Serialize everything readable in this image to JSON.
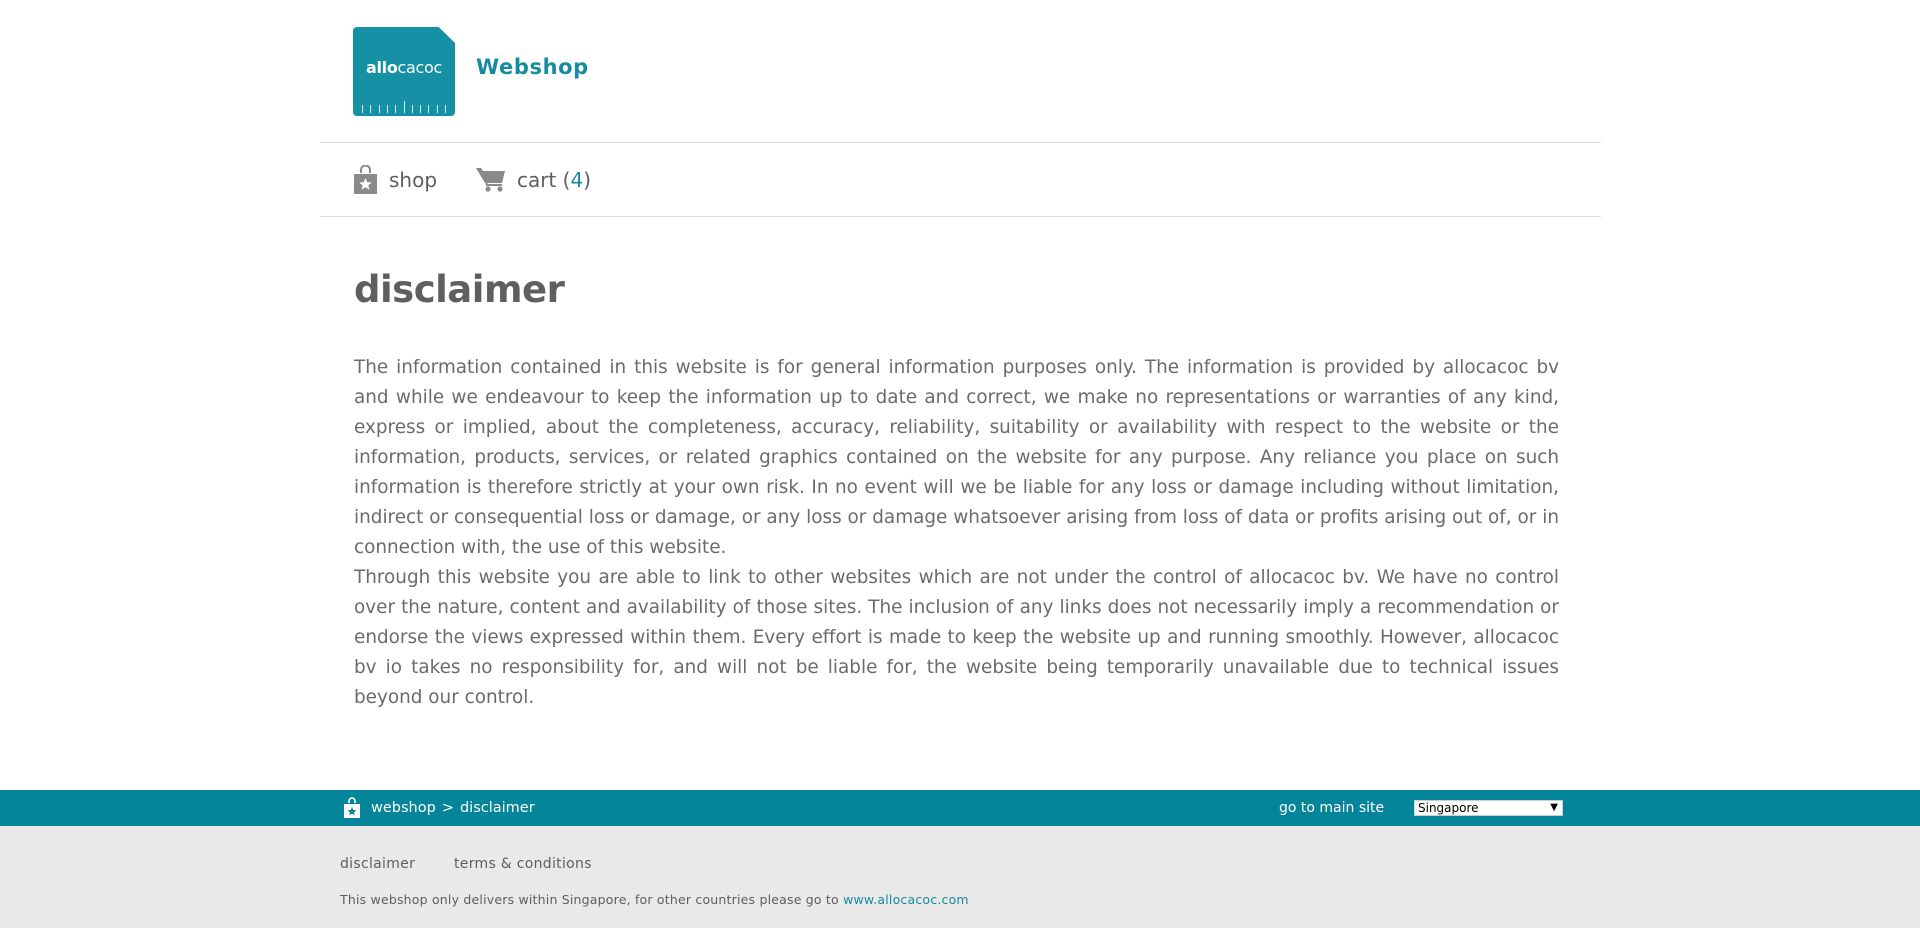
{
  "header": {
    "logo_bold": "allo",
    "logo_light": "cacoc",
    "brand": "Webshop"
  },
  "nav": {
    "shop_label": "shop",
    "cart_label": "cart (",
    "cart_count": "4",
    "cart_close": ")"
  },
  "main": {
    "title": "disclaimer",
    "paragraphs": [
      "The information contained in this website is for general information purposes only. The information is provided by allocacoc bv and while we endeavour to keep the information up to date and correct, we make no representations or warranties of any kind, express or implied, about the completeness, accuracy, reliability, suitability or availability with respect to the website or the information, products, services, or related graphics contained on the website for any purpose. Any reliance you place on such information is therefore strictly at your own risk. In no event will we be liable for any loss or damage including without limitation, indirect or consequential loss or damage, or any loss or damage whatsoever arising from loss of data or profits arising out of, or in connection with, the use of this website.",
      "Through this website you are able to link to other websites which are not under the control of allocacoc bv. We have no control over the nature, content and availability of those sites. The inclusion of any links does not necessarily imply a recommendation or endorse the views expressed within them. Every effort is made to keep the website up and running smoothly. However, allocacoc bv io takes no responsibility for, and will not be liable for, the website being temporarily unavailable due to technical issues beyond our control."
    ]
  },
  "footer_bar": {
    "crumb_home": "webshop",
    "crumb_sep": ">",
    "crumb_current": "disclaimer",
    "main_site_label": "go to main site",
    "country_selected": "Singapore",
    "country_arrow": "▼"
  },
  "bottom": {
    "links": [
      "disclaimer",
      "terms & conditions"
    ],
    "note_text": "This webshop only delivers within Singapore,  for other countries please go to ",
    "note_link": "www.allocacoc.com"
  },
  "colors": {
    "accent": "#158ca0",
    "footer_bar": "#058599",
    "bottom_bg": "#e9e9e9"
  },
  "icons": {
    "shop": "shopping-bag-star-icon",
    "cart": "shopping-cart-icon",
    "crumb": "shopping-bag-star-icon"
  }
}
